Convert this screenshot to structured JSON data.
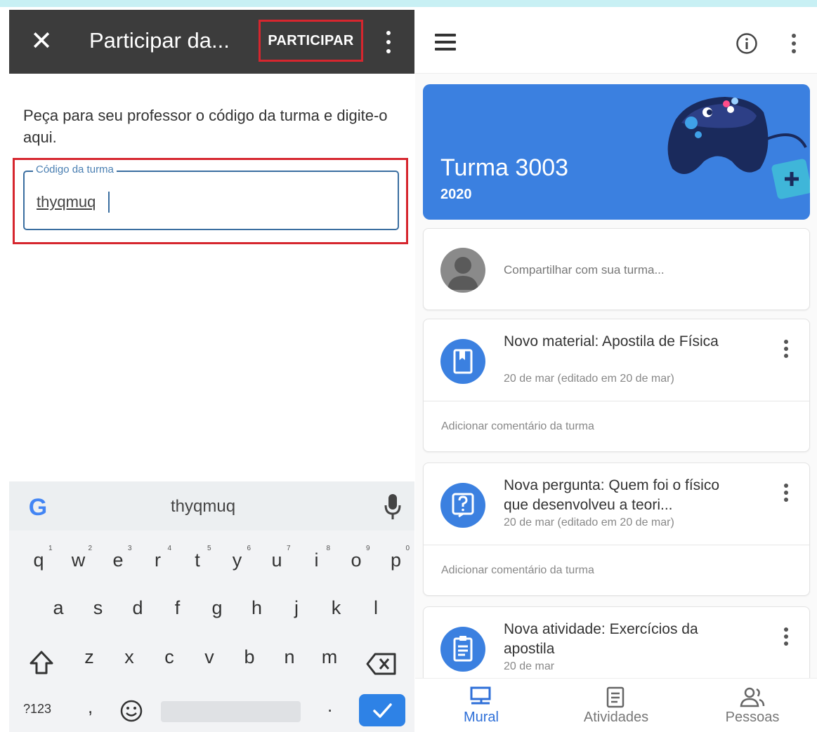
{
  "left": {
    "header": {
      "title": "Participar da...",
      "join_label": "PARTICIPAR"
    },
    "instructions": "Peça para seu professor o código da turma e digite-o aqui.",
    "code_field": {
      "label": "Código da turma",
      "value": "thyqmuq"
    },
    "keyboard": {
      "suggestion": "thyqmuq",
      "row1": [
        {
          "k": "q",
          "n": "1"
        },
        {
          "k": "w",
          "n": "2"
        },
        {
          "k": "e",
          "n": "3"
        },
        {
          "k": "r",
          "n": "4"
        },
        {
          "k": "t",
          "n": "5"
        },
        {
          "k": "y",
          "n": "6"
        },
        {
          "k": "u",
          "n": "7"
        },
        {
          "k": "i",
          "n": "8"
        },
        {
          "k": "o",
          "n": "9"
        },
        {
          "k": "p",
          "n": "0"
        }
      ],
      "row2": [
        "a",
        "s",
        "d",
        "f",
        "g",
        "h",
        "j",
        "k",
        "l"
      ],
      "row3": [
        "z",
        "x",
        "c",
        "v",
        "b",
        "n",
        "m"
      ],
      "symbols_label": "?123",
      "comma": ",",
      "period": "."
    }
  },
  "right": {
    "banner": {
      "title": "Turma 3003",
      "year": "2020",
      "color": "#3b80e0"
    },
    "share_placeholder": "Compartilhar com sua turma...",
    "posts": [
      {
        "title": "Novo material: Apostila de Física",
        "date": "20 de mar (editado em 20 de mar)",
        "comment": "Adicionar comentário da turma",
        "icon": "material-icon"
      },
      {
        "title": "Nova pergunta: Quem foi o físico que desenvolveu a teori...",
        "date": "20 de mar (editado em 20 de mar)",
        "comment": "Adicionar comentário da turma",
        "icon": "question-icon"
      },
      {
        "title": "Nova atividade: Exercícios da apostila",
        "date": "20 de mar",
        "comment": "",
        "icon": "assignment-icon"
      }
    ],
    "bottom_nav": [
      {
        "label": "Mural",
        "icon": "stream-icon",
        "active": true
      },
      {
        "label": "Atividades",
        "icon": "classwork-icon",
        "active": false
      },
      {
        "label": "Pessoas",
        "icon": "people-icon",
        "active": false
      }
    ]
  }
}
